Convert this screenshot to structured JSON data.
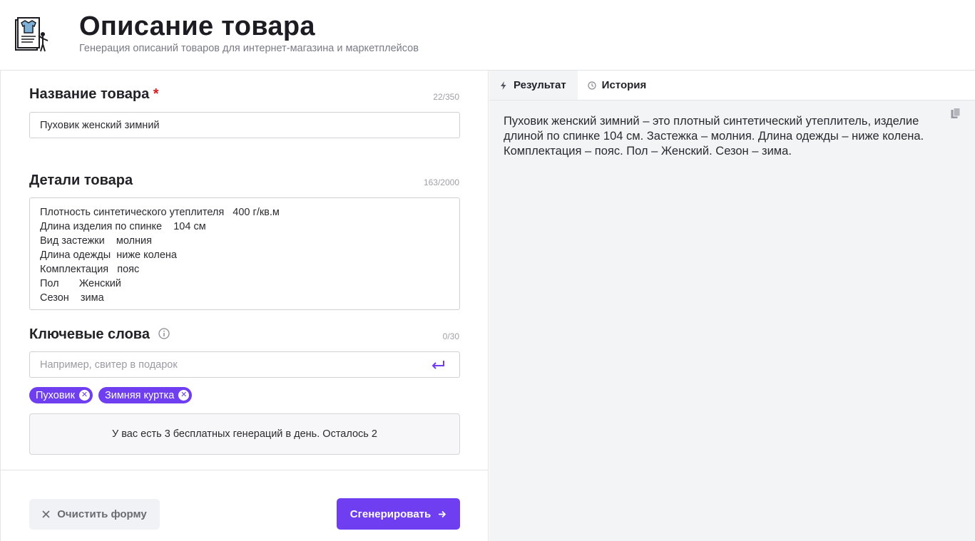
{
  "header": {
    "title": "Описание товара",
    "subtitle": "Генерация описаний товаров для интернет-магазина и маркетплейсов",
    "logo_icon": "product-presentation-icon"
  },
  "form": {
    "name_field": {
      "label": "Название товара",
      "required_mark": "*",
      "counter": "22/350",
      "value": "Пуховик женский зимний"
    },
    "details_field": {
      "label": "Детали товара",
      "counter": "163/2000",
      "lines": [
        "Плотность синтетического утеплителя   400 г/кв.м",
        "Длина изделия по спинке    104 см",
        "Вид застежки    молния",
        "Длина одежды  ниже колена",
        "Комплектация   пояс",
        "Пол       Женский",
        "Сезон    зима"
      ]
    },
    "keywords_field": {
      "label": "Ключевые слова",
      "counter": "0/30",
      "placeholder": "Например, свитер в подарок",
      "tags": [
        "Пуховик",
        "Зимняя куртка"
      ]
    },
    "notice": "У вас есть 3 бесплатных генераций в день. Осталось 2",
    "clear_button": "Очистить форму",
    "generate_button": "Сгенерировать"
  },
  "result_panel": {
    "tabs": [
      {
        "label": "Результат",
        "icon": "lightning-icon",
        "active": true
      },
      {
        "label": "История",
        "icon": "clock-icon",
        "active": false
      }
    ],
    "text": "Пуховик женский зимний – это плотный синтетический утеплитель, изделие длиной по спинке 104 см. Застежка – молния. Длина одежды – ниже колена. Комплектация – пояс. Пол – Женский. Сезон – зима."
  },
  "colors": {
    "accent": "#6e3ef0",
    "required": "#d61f1f",
    "panel_bg": "#f3f4f6"
  }
}
